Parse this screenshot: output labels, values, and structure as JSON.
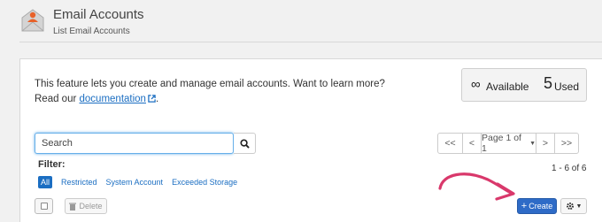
{
  "header": {
    "title": "Email Accounts",
    "subtitle": "List Email Accounts",
    "icon": "email-accounts-icon"
  },
  "intro": {
    "text": "This feature lets you create and manage email accounts. Want to learn more? Read our",
    "link_label": "documentation",
    "link_suffix": "."
  },
  "stats": {
    "available_symbol": "∞",
    "available_label": "Available",
    "used_count": "5",
    "used_label": "Used"
  },
  "search": {
    "placeholder": "Search",
    "value": ""
  },
  "pagination": {
    "first": "<<",
    "prev": "<",
    "page_label": "Page 1 of 1",
    "next": ">",
    "last": ">>"
  },
  "filter": {
    "label": "Filter:",
    "options": [
      "All",
      "Restricted",
      "System Account",
      "Exceeded Storage"
    ],
    "active": "All"
  },
  "results_count": "1 - 6 of 6",
  "actions": {
    "delete_label": "Delete",
    "create_label": "Create"
  },
  "colors": {
    "accent": "#2e6bc7",
    "link": "#1b6ec2",
    "annotation_arrow": "#d9386b",
    "header_icon": "#e8622a"
  }
}
